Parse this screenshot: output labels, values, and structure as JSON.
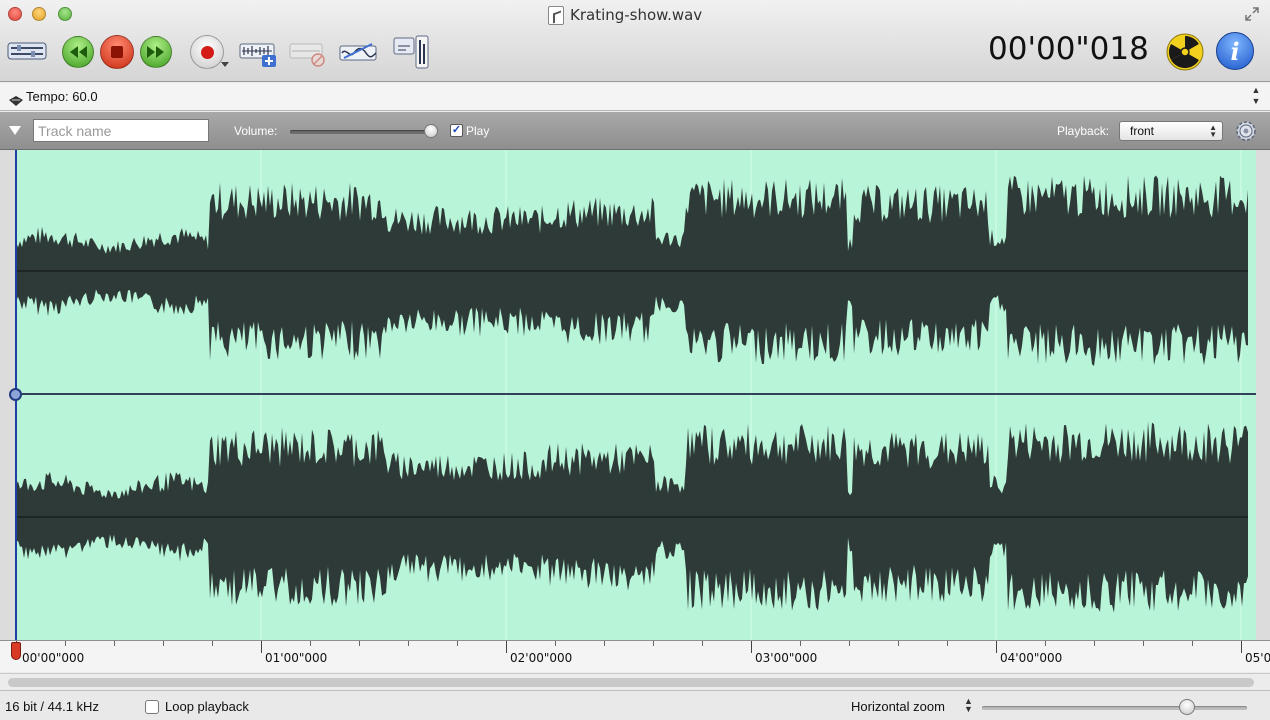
{
  "window": {
    "title": "Krating-show.wav"
  },
  "toolbar": {
    "buttons": [
      {
        "name": "mixer",
        "icon": "mixer-icon"
      },
      {
        "name": "rewind",
        "icon": "rewind-icon"
      },
      {
        "name": "stop",
        "icon": "stop-icon"
      },
      {
        "name": "fast-forward",
        "icon": "fast-forward-icon"
      },
      {
        "name": "record",
        "icon": "record-icon"
      },
      {
        "name": "add-track",
        "icon": "add-track-icon"
      },
      {
        "name": "remove-track",
        "icon": "remove-track-icon"
      },
      {
        "name": "effects",
        "icon": "effects-icon"
      },
      {
        "name": "meters",
        "icon": "meters-icon"
      }
    ],
    "timecode": "00'00\"018"
  },
  "tempo": {
    "label": "Tempo: 60.0"
  },
  "track": {
    "name_placeholder": "Track name",
    "name_value": "",
    "volume_label": "Volume:",
    "volume_level": 0.93,
    "play_label": "Play",
    "play_checked": true,
    "playback_label": "Playback:",
    "playback_value": "front"
  },
  "ruler": {
    "labels": [
      "00'00\"000",
      "01'00\"000",
      "02'00\"000",
      "03'00\"000",
      "04'00\"000",
      "05'0"
    ]
  },
  "status": {
    "format": "16 bit / 44.1 kHz",
    "loop_label": "Loop playback",
    "loop_checked": false,
    "zoom_label": "Horizontal zoom",
    "zoom_level": 0.78
  },
  "colors": {
    "wave_bg": "#b8f4d8",
    "wave_fill": "#2e3a37",
    "playhead": "#1f3fa7"
  }
}
